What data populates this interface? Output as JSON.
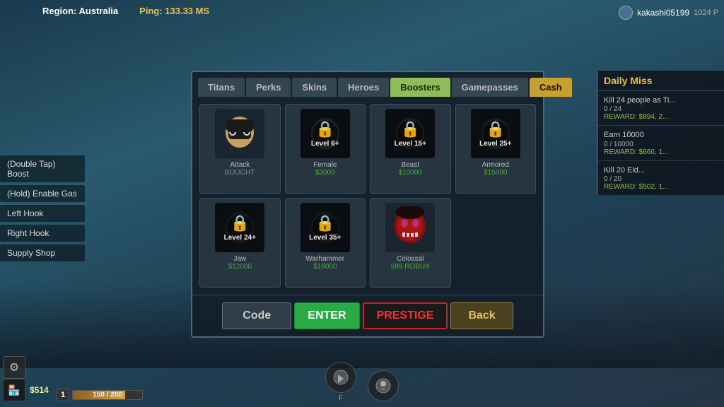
{
  "topBar": {
    "region": "Region: Australia",
    "ping": "Ping: 133.33 MS"
  },
  "topRight": {
    "username": "kakashi05199",
    "userId": "1024 P"
  },
  "leftButtons": [
    {
      "label": "(Double Tap) Boost"
    },
    {
      "label": "(Hold) Enable Gas"
    },
    {
      "label": "Left Hook"
    },
    {
      "label": "Right Hook"
    },
    {
      "label": "Supply Shop"
    }
  ],
  "shopPanel": {
    "tabs": [
      {
        "label": "Titans",
        "active": false
      },
      {
        "label": "Perks",
        "active": false
      },
      {
        "label": "Skins",
        "active": false
      },
      {
        "label": "Heroes",
        "active": false
      },
      {
        "label": "Boosters",
        "active": true
      },
      {
        "label": "Gamepasses",
        "active": false
      },
      {
        "label": "Cash",
        "active": false,
        "special": "cash"
      }
    ],
    "items": [
      {
        "name": "Attack",
        "price": "BOUGHT",
        "locked": false,
        "priceClass": "bought"
      },
      {
        "name": "Female",
        "price": "$3000",
        "locked": true,
        "lockLevel": "Level 6+",
        "priceClass": "normal"
      },
      {
        "name": "Beast",
        "price": "$10000",
        "locked": true,
        "lockLevel": "Level 15+",
        "priceClass": "normal"
      },
      {
        "name": "Armored",
        "price": "$15000",
        "locked": true,
        "lockLevel": "Level 25+",
        "priceClass": "normal"
      },
      {
        "name": "Jaw",
        "price": "$12000",
        "locked": true,
        "lockLevel": "Level 24+",
        "priceClass": "normal"
      },
      {
        "name": "Warhammer",
        "price": "$16000",
        "locked": true,
        "lockLevel": "Level 35+",
        "priceClass": "normal"
      },
      {
        "name": "Colossal",
        "price": "599 ROBUX",
        "locked": false,
        "priceClass": "robux"
      }
    ],
    "bottomButtons": {
      "code": "Code",
      "enter": "ENTER",
      "prestige": "PRESTIGE",
      "back": "Back"
    }
  },
  "dailyMissions": {
    "title": "Daily Miss",
    "missions": [
      {
        "desc": "Kill 24 people as Ti...",
        "progress": "0 / 24",
        "reward": "REWARD: $894, 2..."
      },
      {
        "desc": "Earn 10000",
        "progress": "0 / 10000",
        "reward": "REWARD: $660, 1..."
      },
      {
        "desc": "Kill 20 Eld...",
        "progress": "0 / 20",
        "reward": "REWARD: $502, 1..."
      }
    ]
  },
  "bottomBar": {
    "cash": "$514",
    "level": "1",
    "xp": "150 / 200",
    "actionF": "F",
    "actionLabel": ""
  }
}
